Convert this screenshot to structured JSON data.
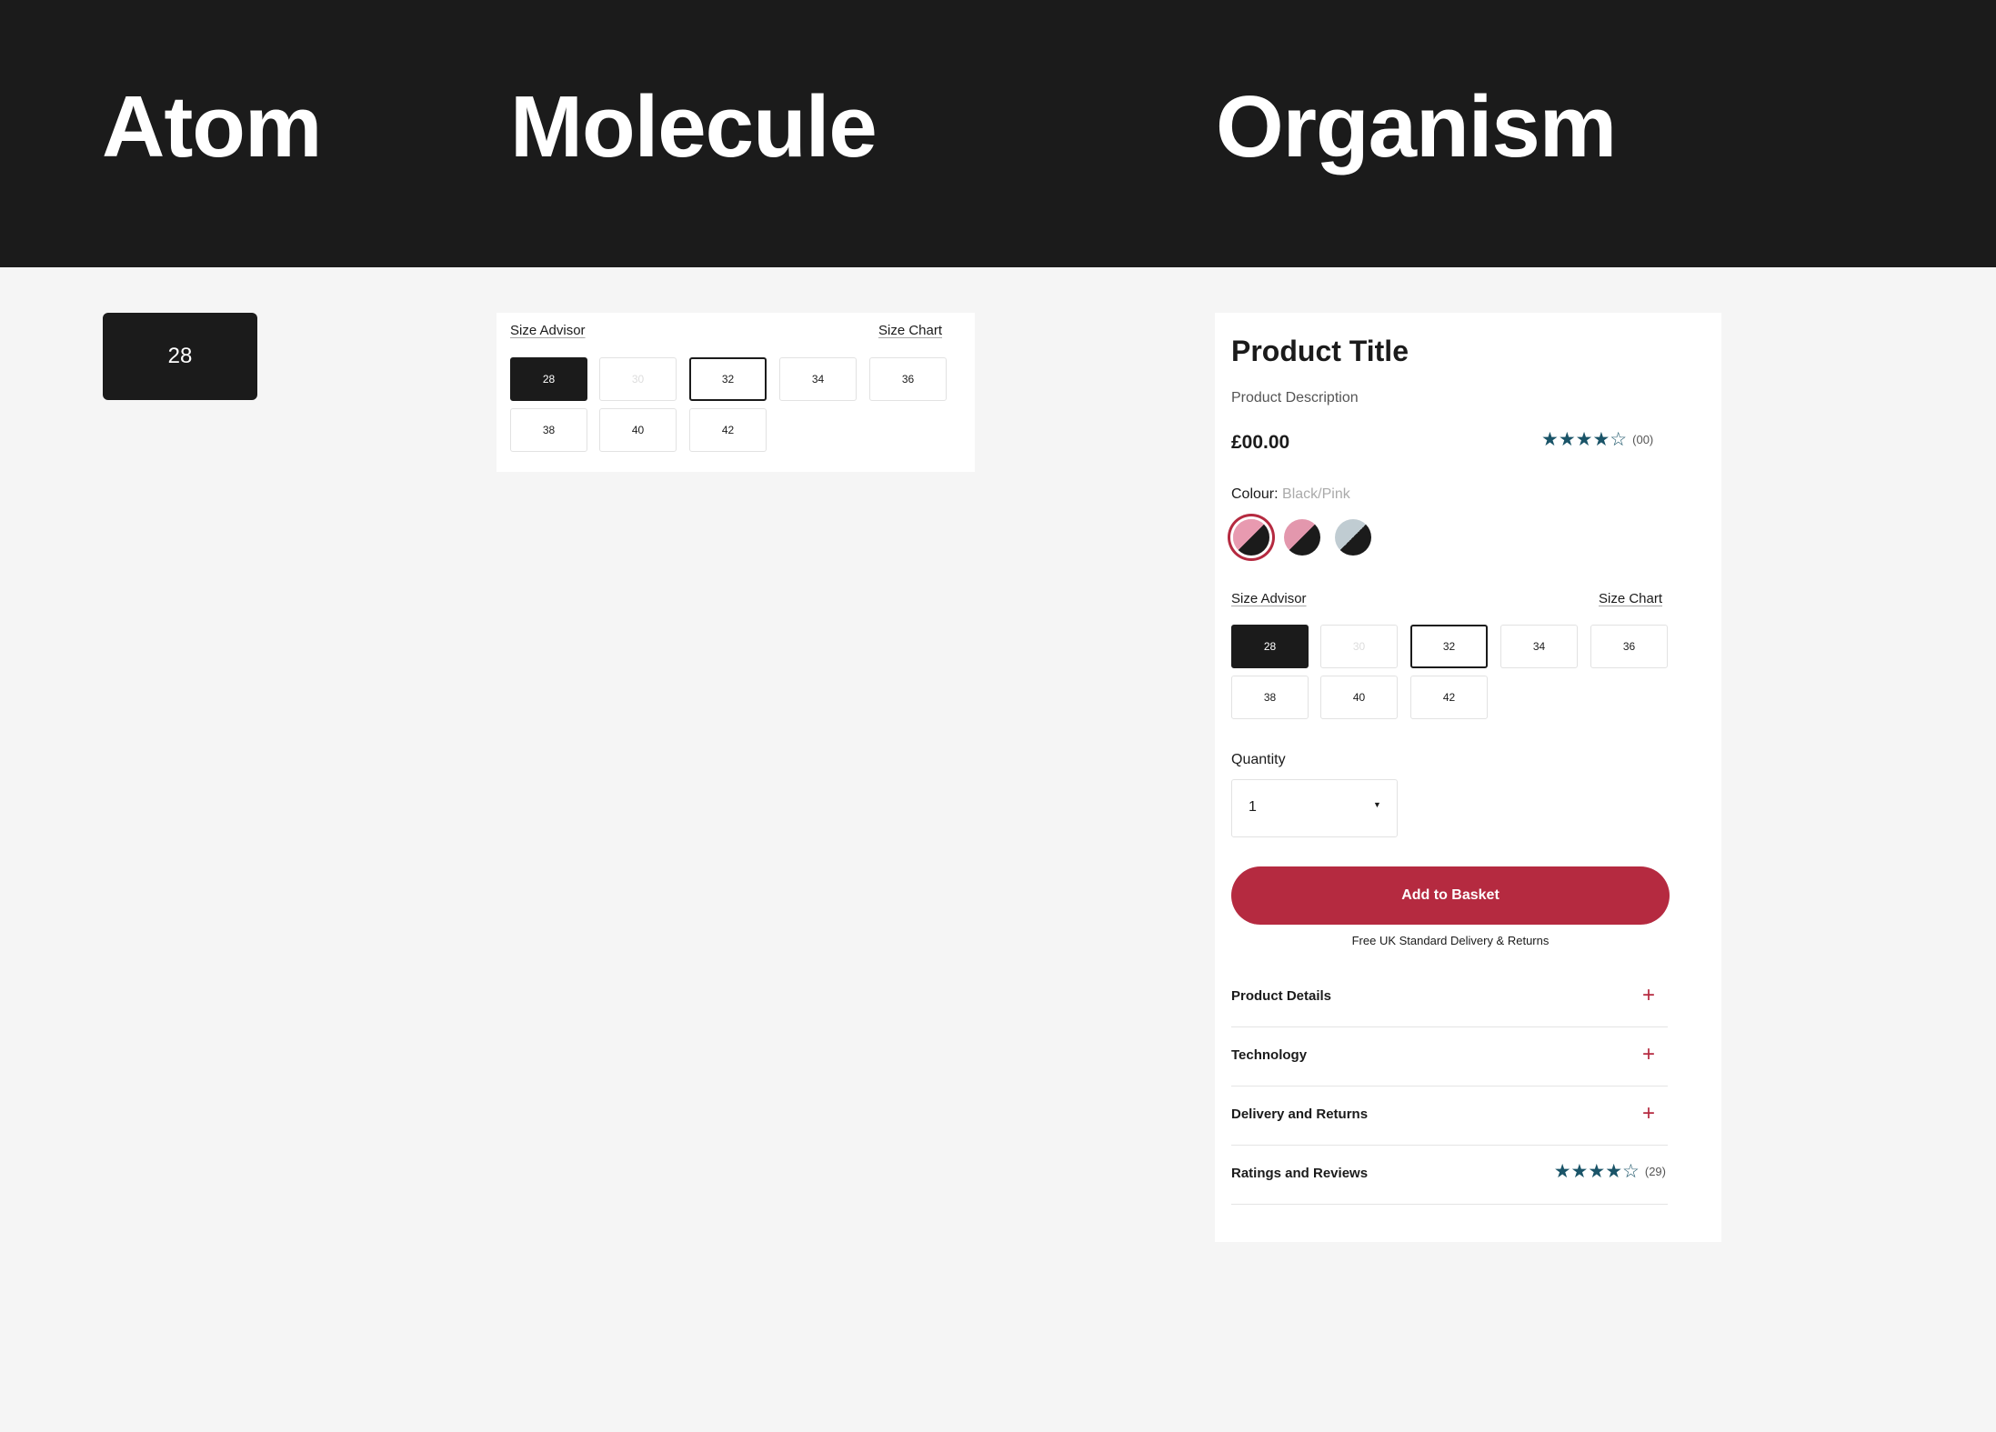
{
  "header": {
    "atom": "Atom",
    "molecule": "Molecule",
    "organism": "Organism"
  },
  "atom": {
    "size": "28"
  },
  "size_selector": {
    "advisor": "Size Advisor",
    "chart": "Size Chart",
    "sizes": [
      {
        "label": "28",
        "state": "selected"
      },
      {
        "label": "30",
        "state": "disabled"
      },
      {
        "label": "32",
        "state": "focused"
      },
      {
        "label": "34",
        "state": "default"
      },
      {
        "label": "36",
        "state": "default"
      },
      {
        "label": "38",
        "state": "default"
      },
      {
        "label": "40",
        "state": "default"
      },
      {
        "label": "42",
        "state": "default"
      }
    ]
  },
  "product": {
    "title": "Product Title",
    "description": "Product Description",
    "price": "£00.00",
    "rating": {
      "stars": 4,
      "max": 5,
      "count": "(00)"
    },
    "colour_label": "Colour:",
    "colour_value": "Black/Pink",
    "swatches": [
      {
        "name": "Black/Pink",
        "top": "#e89ab0",
        "bottom": "#1b1b1b",
        "selected": true
      },
      {
        "name": "Pink/Black",
        "top": "#e397ad",
        "bottom": "#1b1b1b",
        "selected": false
      },
      {
        "name": "Grey/Black",
        "top": "#c0ccd2",
        "bottom": "#1b1b1b",
        "selected": false
      }
    ],
    "quantity_label": "Quantity",
    "quantity_value": "1",
    "add_to_basket": "Add to Basket",
    "delivery_note": "Free UK Standard Delivery & Returns",
    "accordion": [
      {
        "label": "Product Details"
      },
      {
        "label": "Technology"
      },
      {
        "label": "Delivery and Returns"
      },
      {
        "label": "Ratings and Reviews",
        "rating": {
          "stars": 4,
          "max": 5,
          "count": "(29)"
        }
      }
    ]
  },
  "colors": {
    "dark": "#1b1b1b",
    "accent": "#b52a40",
    "star": "#1a5468",
    "background": "#f5f5f5"
  }
}
